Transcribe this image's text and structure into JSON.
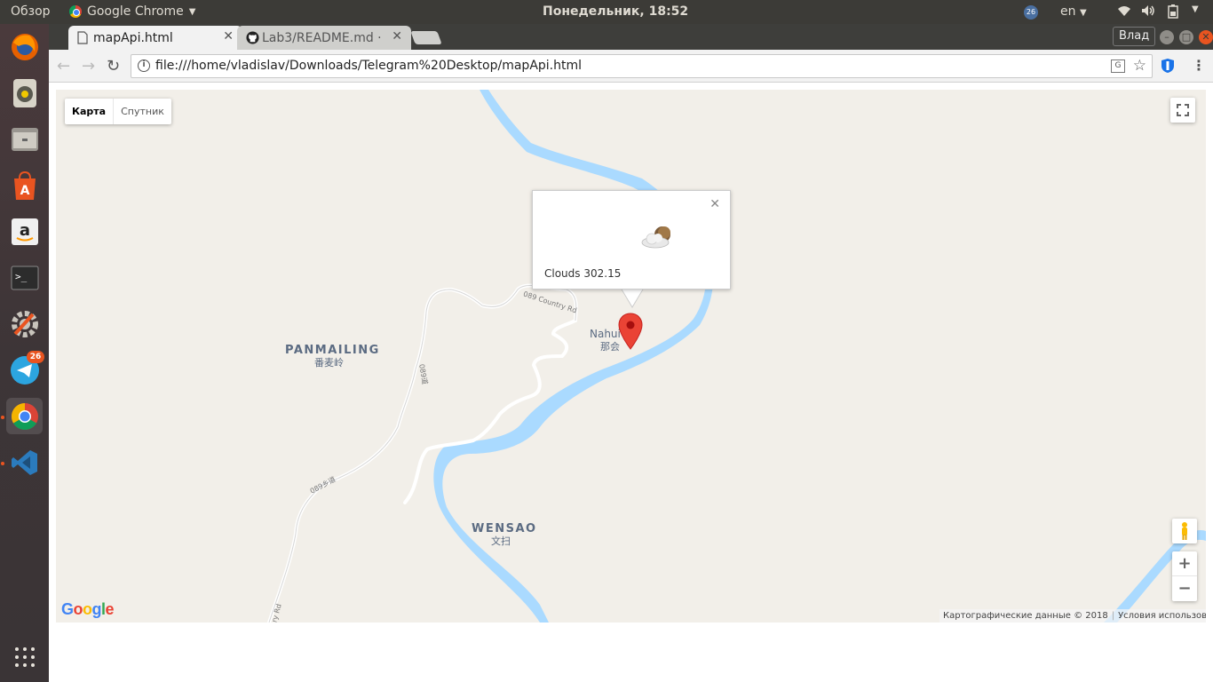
{
  "system_bar": {
    "overview": "Обзор",
    "app_name": "Google Chrome",
    "clock": "Понедельник, 18:52",
    "notification_count": "26",
    "language": "en"
  },
  "dock": {
    "telegram_badge": "26"
  },
  "browser": {
    "tabs": [
      {
        "title": "mapApi.html"
      },
      {
        "title": "Lab3/README.md ·"
      }
    ],
    "profile_name": "Влад",
    "url": "file:///home/vladislav/Downloads/Telegram%20Desktop/mapApi.html"
  },
  "map": {
    "map_type": {
      "map": "Карта",
      "satellite": "Спутник"
    },
    "places": [
      {
        "name": "PANMAILING",
        "native": "番麦岭"
      },
      {
        "name": "WENSAO",
        "native": "文扫"
      },
      {
        "name": "Nahui",
        "native": "那会"
      }
    ],
    "roads": {
      "country_rd": "089 Country Rd",
      "road_vertical": "089道",
      "road_xiang": "089乡道",
      "road_bottom": "ry Rd"
    },
    "info_window": {
      "text": "Clouds 302.15",
      "weather_icon": "partly-cloudy-night-icon"
    },
    "logo": "Google",
    "attribution": "Картографические данные © 2018",
    "terms": "Условия использования",
    "zoom_in": "+",
    "zoom_out": "−"
  },
  "colors": {
    "water": "#aadaff",
    "land": "#f2efe9",
    "marker": "#ea4335",
    "ubuntu_accent": "#e95420"
  }
}
